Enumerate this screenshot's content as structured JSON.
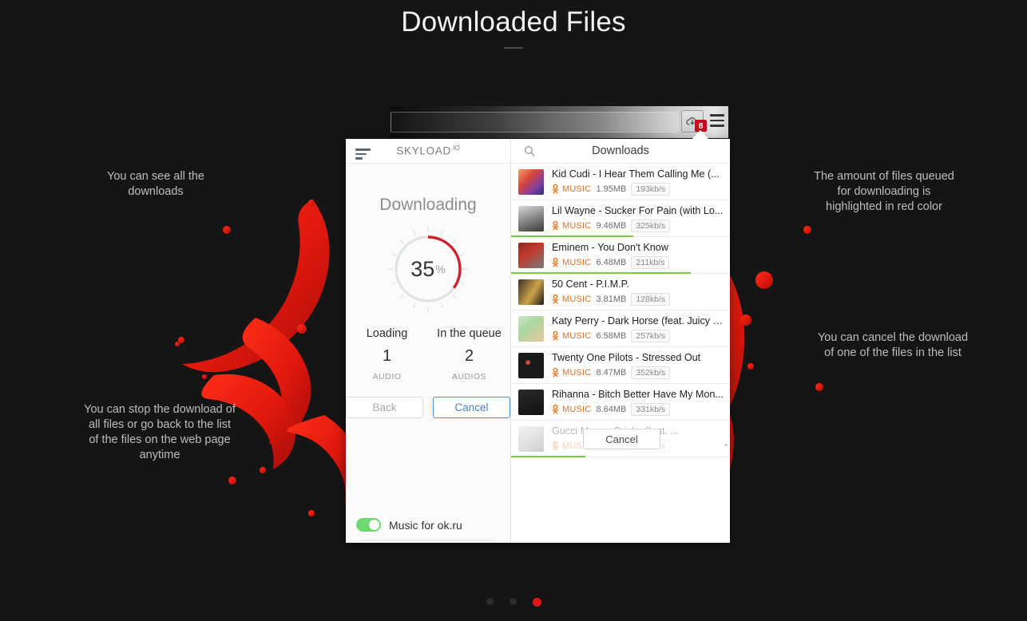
{
  "page": {
    "title": "Downloaded Files"
  },
  "annotations": {
    "see_all": "You can see all the downloads",
    "stop_download": "You can stop the download of all files or go back to the list of the files on the web page anytime",
    "queued_red": "The amount of files queued for downloading is highlighted in red color",
    "cancel_one": "You can cancel the download of one of the files in the list"
  },
  "browser": {
    "url_value": "",
    "url_placeholder": "",
    "extension_badge": "8",
    "extension_icon": "cloud-download-icon",
    "menu_icon": "hamburger-menu-icon"
  },
  "left_pane": {
    "menu_icon": "hamburger-menu-icon",
    "brand": "SKYLOAD",
    "brand_sup": ".IO",
    "status_title": "Downloading",
    "progress": {
      "percent": 35,
      "percent_text": "35",
      "percent_symbol": "%",
      "ring_color": "#d0202e",
      "track_color": "#dfe3e6"
    },
    "counts": [
      {
        "label": "Loading",
        "value": "1",
        "unit": "AUDIO"
      },
      {
        "label": "In the queue",
        "value": "2",
        "unit": "AUDIOS"
      }
    ],
    "buttons": {
      "back": "Back",
      "cancel": "Cancel"
    },
    "toggle": {
      "label": "Music for ok.ru",
      "enabled": true,
      "color": "#6fd86f"
    }
  },
  "right_pane": {
    "search_icon": "search-icon",
    "header_title": "Downloads",
    "cancel_overlay_label": "Cancel",
    "items": [
      {
        "title": "Kid Cudi - I Hear Them Calling Me (...",
        "source": "MUSIC",
        "size": "1.95MB",
        "speed": "193kb/s",
        "progress": 0,
        "thumb": "linear-gradient(135deg,#f4a06a 0%,#d8453c 38%,#7c3fa6 72%,#2a2a6e 100%)"
      },
      {
        "title": "Lil Wayne - Sucker For Pain (with Lo...",
        "source": "MUSIC",
        "size": "9.46MB",
        "speed": "325kb/s",
        "progress": 56,
        "thumb": "linear-gradient(160deg,#d9d9d9 0%,#8f8f8f 45%,#3a3a3a 100%)"
      },
      {
        "title": "Eminem - You Don't Know",
        "source": "MUSIC",
        "size": "6.48MB",
        "speed": "211kb/s",
        "progress": 82,
        "thumb": "linear-gradient(145deg,#8b2a20 0%,#c0392b 40%,#7a7a7a 100%)"
      },
      {
        "title": "50 Cent - P.I.M.P.",
        "source": "MUSIC",
        "size": "3.81MB",
        "speed": "128kb/s",
        "progress": 0,
        "thumb": "linear-gradient(120deg,#3d3327 0%,#caa24a 55%,#1e1a16 100%)"
      },
      {
        "title": "Katy Perry - Dark Horse (feat. Juicy J...",
        "source": "MUSIC",
        "size": "6.58MB",
        "speed": "257kb/s",
        "progress": 0,
        "thumb": "linear-gradient(140deg,#cfe6c9 0%,#a9d6a0 40%,#e8c9a0 100%)"
      },
      {
        "title": "Twenty One Pilots - Stressed Out",
        "source": "MUSIC",
        "size": "8.47MB",
        "speed": "352kb/s",
        "progress": 0,
        "thumb": "radial-gradient(circle at 38% 38%, #c94b3a 0 10%, transparent 11%), #1a1a1a"
      },
      {
        "title": "Rihanna - Bitch Better Have My Mon...",
        "source": "MUSIC",
        "size": "8.64MB",
        "speed": "331kb/s",
        "progress": 0,
        "thumb": "linear-gradient(160deg,#2b2b2b 0%,#101010 100%)"
      },
      {
        "title": "Gucci Mane - Bricks (feat. ...",
        "source": "MUSIC",
        "size": "7.12MB",
        "speed": "284kb/s",
        "progress": 34,
        "thumb": "linear-gradient(150deg,#d7d7d7 0%,#9a9a9a 60%,#5d5d5d 100%)",
        "faded": true,
        "has_cancel_overlay": true
      }
    ]
  },
  "pagination": {
    "dots": 3,
    "active_index": 2,
    "active_color": "#e01414"
  }
}
